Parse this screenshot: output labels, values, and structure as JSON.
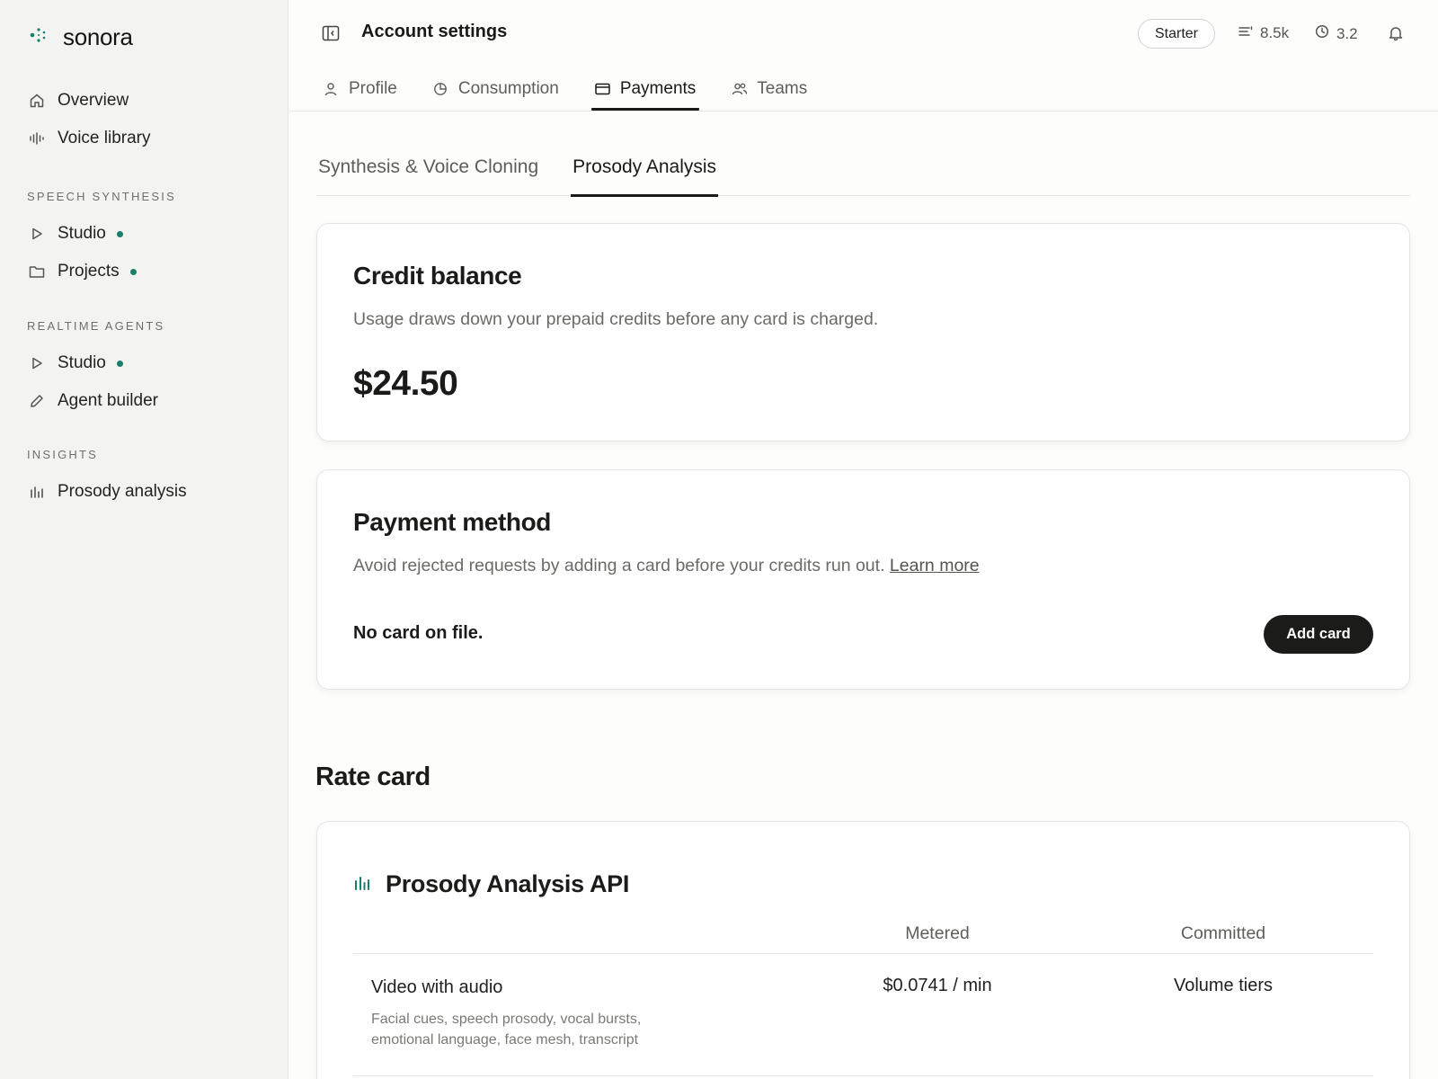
{
  "brand": {
    "name": "sonora",
    "accent": "#16806a"
  },
  "sidebar": {
    "top_items": [
      {
        "label": "Overview",
        "icon": "home-icon"
      },
      {
        "label": "Voice library",
        "icon": "waveform-icon"
      }
    ],
    "sections": [
      {
        "title": "SPEECH SYNTHESIS",
        "items": [
          {
            "label": "Studio",
            "icon": "play-icon",
            "dot": true
          },
          {
            "label": "Projects",
            "icon": "folder-icon",
            "dot": true
          }
        ]
      },
      {
        "title": "REALTIME AGENTS",
        "items": [
          {
            "label": "Studio",
            "icon": "play-icon",
            "dot": true
          },
          {
            "label": "Agent builder",
            "icon": "pencil-icon",
            "dot": false
          }
        ]
      },
      {
        "title": "INSIGHTS",
        "items": [
          {
            "label": "Prosody analysis",
            "icon": "bar-chart-icon",
            "dot": false
          }
        ]
      }
    ]
  },
  "header": {
    "title": "Account settings",
    "plan": "Starter",
    "credits_stat": "8.5k",
    "time_stat": "3.2"
  },
  "tabs": [
    {
      "label": "Profile",
      "icon": "user-icon",
      "active": false
    },
    {
      "label": "Consumption",
      "icon": "pie-icon",
      "active": false
    },
    {
      "label": "Payments",
      "icon": "card-icon",
      "active": true
    },
    {
      "label": "Teams",
      "icon": "users-icon",
      "active": false
    }
  ],
  "subtabs": [
    {
      "label": "Synthesis & Voice Cloning",
      "active": false
    },
    {
      "label": "Prosody Analysis",
      "active": true
    }
  ],
  "credit": {
    "title": "Credit balance",
    "description": "Usage draws down your prepaid credits before any card is charged.",
    "amount": "$24.50"
  },
  "payment": {
    "title": "Payment method",
    "description": "Avoid rejected requests by adding a card before your credits run out.",
    "learn_more": "Learn more",
    "status": "No card on file.",
    "button": "Add card"
  },
  "rate_card": {
    "title": "Rate card",
    "api_title": "Prosody Analysis API",
    "columns": [
      "Metered",
      "Committed"
    ],
    "rows": [
      {
        "name": "Video with audio",
        "description": "Facial cues, speech prosody, vocal bursts, emotional language, face mesh, transcript",
        "metered": "$0.0741 / min",
        "committed": "Volume tiers"
      }
    ]
  }
}
